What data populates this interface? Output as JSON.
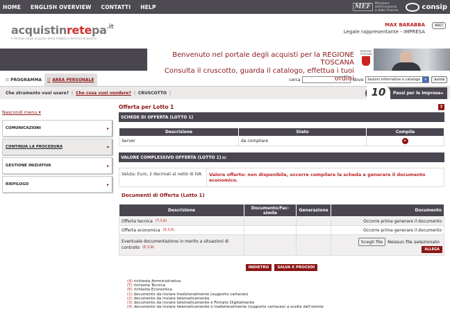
{
  "topnav": {
    "items": [
      "HOME",
      "ENGLISH OVERVIEW",
      "CONTATTI",
      "HELP"
    ],
    "mef_logo": "MEF",
    "mef_text": [
      "Ministero",
      "dell'Economia",
      "e delle Finanze"
    ],
    "consip": "consip"
  },
  "header": {
    "logo_part1": "acquistin",
    "logo_part2": "rete",
    "logo_part3": "pa",
    "logo_it": ".it",
    "logo_sub": "Il Portale degli acquisti della Pubblica Amministrazione",
    "user_name": "MAX BARABBA",
    "user_role": "Legale rappresentante - IMPRESA",
    "esci": "esci"
  },
  "banner": {
    "line1": "Benvenuto nel portale degli acquisti per la REGIONE TOSCANA",
    "line2": "Consulta il cruscotto, guarda il catalogo, effettua i tuoi ordini",
    "crest_text": [
      "REGIONE",
      "TOSCANA"
    ]
  },
  "progbar": {
    "programma": "PROGRAMMA",
    "area_personale": "AREA PERSONALE",
    "search_label": "cerca",
    "search_value": "",
    "dove_label": "dove",
    "dove_value": "Sezioni informative e catalogo",
    "avvia": "avvia"
  },
  "quickbar": {
    "q1": "Che strumento vuoi usare?",
    "q2": "Che cosa vuoi vendere?",
    "q3": "CRUSCOTTO",
    "sep": "|",
    "ten_num": "10",
    "ten_text": "Passi per le Imprese"
  },
  "sidebar": {
    "hide_menu": "Nascondi menu",
    "items": [
      {
        "label": "COMUNICAZIONI"
      },
      {
        "label": "CONTINUA LA PROCEDURA"
      },
      {
        "label": "GESTIONE INIZIATIVA"
      },
      {
        "label": "RIEPILOGO"
      }
    ]
  },
  "main": {
    "title": "Offerta per Lotto 1",
    "help": "?",
    "schede_title": "SCHEDE DI OFFERTA (LOTTO 1)",
    "schede_headers": [
      "Descrizione",
      "Stato",
      "Compila"
    ],
    "schede_rows": [
      {
        "descrizione": "Server",
        "stato": "da compilare"
      }
    ],
    "valore_title": "VALORE COMPLESSIVO OFFERTA (LOTTO 1)",
    "valore_ref": "(E)",
    "valore_left": "Valuta: Euro, 2 decimali al netto di IVA",
    "valore_right": "Valore offerto: non disponibile, occorre compilare la scheda e generare il documento economico.",
    "docs_title": "Documenti di Offerta (Lotto 1)",
    "docs_headers": [
      "Descrizione",
      "Documento/Fac-simile",
      "Generazione",
      "Documento"
    ],
    "docs_rows": [
      {
        "descrizione": "Offerta tecnica",
        "refs": "(T,3,6)",
        "documento": "Occorre prima generare il documento"
      },
      {
        "descrizione": "Offerta economica",
        "refs": "(E,3,6)",
        "documento": "Occorre prima generare il documento"
      }
    ],
    "extra_doc": {
      "descrizione": "Eventuale documentazione in merito a situazioni di controllo",
      "refs": "(E,3,9)",
      "file_button": "Scegli file",
      "file_label": "Nessun file selezionato",
      "allega": "ALLEGA"
    },
    "buttons": {
      "indietro": "INDIETRO",
      "salva": "SALVA E PROCEDI"
    },
    "legend": [
      {
        "code": "(A)",
        "text": "richiesta Amministrativa"
      },
      {
        "code": "(T)",
        "text": "richiesta Tecnica"
      },
      {
        "code": "(E)",
        "text": "richiesta Economica"
      },
      {
        "code": "(1)",
        "text": "documento da inviare tradizionalmente (supporto cartaceo)"
      },
      {
        "code": "(2)",
        "text": "documento da inviare telematicamente"
      },
      {
        "code": "(3)",
        "text": "documento da inviare telematicamente e Firmato Digitalmente"
      },
      {
        "code": "(4)",
        "text": "documento da inviare telematicamente o tradizionalmente (supporto cartaceo) a scelta dell'utente"
      }
    ]
  },
  "colors": {
    "accent": "#8b1515",
    "dark_bar": "#4a4650",
    "light_bar": "#ece9e9"
  }
}
